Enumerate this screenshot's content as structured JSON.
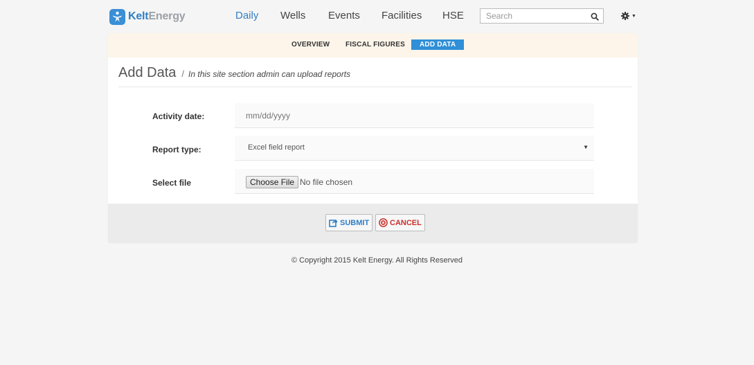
{
  "brand": {
    "name_part1": "Kelt",
    "name_part2": "Energy"
  },
  "nav": {
    "items": [
      {
        "label": "Daily",
        "active": true
      },
      {
        "label": "Wells"
      },
      {
        "label": "Events"
      },
      {
        "label": "Facilities"
      },
      {
        "label": "HSE"
      }
    ],
    "search": {
      "placeholder": "Search"
    }
  },
  "subnav": {
    "items": [
      {
        "label": "OVERVIEW"
      },
      {
        "label": "FISCAL FIGURES"
      },
      {
        "label": "ADD DATA",
        "active": true
      }
    ]
  },
  "page": {
    "title": "Add Data",
    "separator": "/",
    "subtitle": "In this site section admin can upload reports"
  },
  "form": {
    "activity_date": {
      "label": "Activity date:",
      "placeholder": "mm/dd/yyyy"
    },
    "report_type": {
      "label": "Report type:",
      "value": "Excel field report"
    },
    "file": {
      "label": "Select file",
      "button_label": "Choose File",
      "status": "No file chosen"
    },
    "submit_label": "SUBMIT",
    "cancel_label": "CANCEL"
  },
  "footer": {
    "copyright": "© Copyright 2015 Kelt Energy. All Rights Reserved"
  },
  "colors": {
    "accent": "#2f7fc6",
    "danger": "#c9302c",
    "subnav_bg": "#fdf5ea"
  }
}
